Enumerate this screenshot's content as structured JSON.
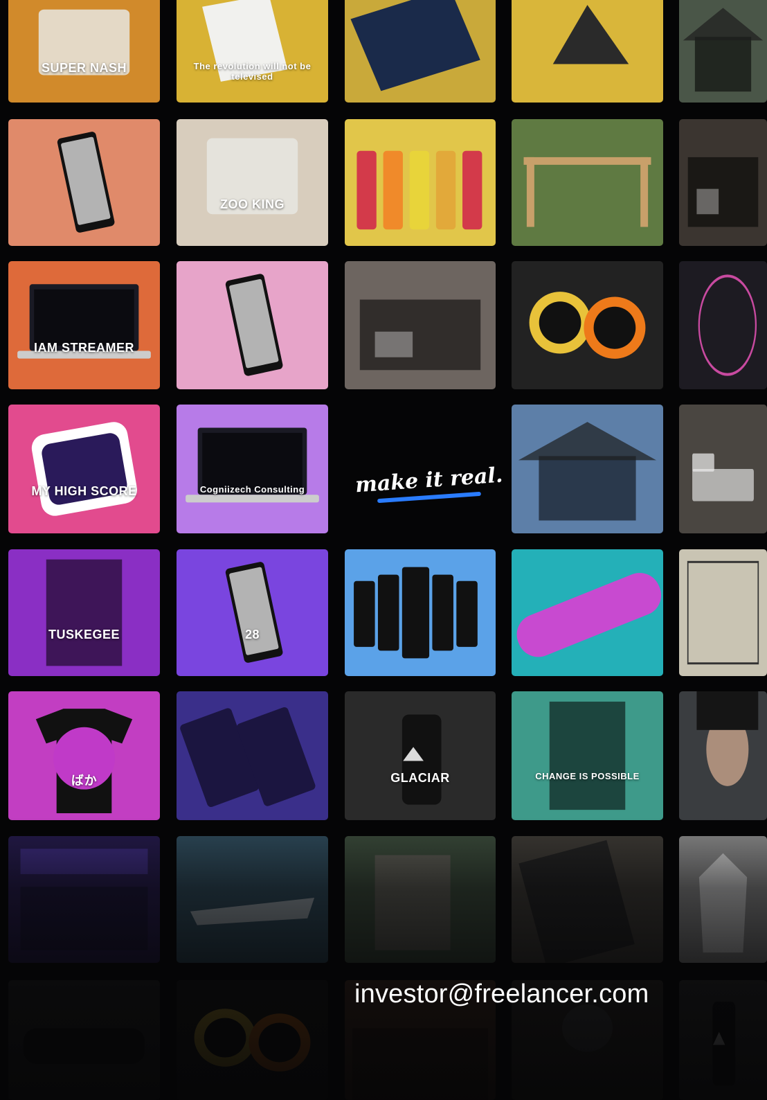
{
  "tagline": "make it real.",
  "contact": {
    "email": "investor@freelancer.com"
  },
  "tiles": [
    {
      "id": "r1c1",
      "color": "#d18a2b",
      "label": "SUPER NASH",
      "icon": "package-box-icon"
    },
    {
      "id": "r1c2",
      "color": "#d8b234",
      "label": "The revolution will not be televised",
      "icon": "newspaper-icon"
    },
    {
      "id": "r1c3",
      "color": "#c9a93a",
      "label": "",
      "icon": "book-icon"
    },
    {
      "id": "r1c4",
      "color": "#d9b63a",
      "label": "",
      "icon": "speaker-icon"
    },
    {
      "id": "r1c5",
      "color": "#4a5648",
      "label": "",
      "icon": "house-icon"
    },
    {
      "id": "r2c1",
      "color": "#e08a6a",
      "label": "",
      "icon": "phone-icon"
    },
    {
      "id": "r2c2",
      "color": "#d8cdbd",
      "label": "ZOO KING",
      "icon": "package-box-icon"
    },
    {
      "id": "r2c3",
      "color": "#e1c64a",
      "label": "",
      "icon": "bottles-icon"
    },
    {
      "id": "r2c4",
      "color": "#5f7a42",
      "label": "",
      "icon": "pergola-icon"
    },
    {
      "id": "r2c5",
      "color": "#3b3530",
      "label": "",
      "icon": "interior-icon"
    },
    {
      "id": "r3c1",
      "color": "#de6a3a",
      "label": "IAM STREAMER",
      "icon": "laptop-icon"
    },
    {
      "id": "r3c2",
      "color": "#e7a4c9",
      "label": "",
      "icon": "phone-icon"
    },
    {
      "id": "r3c3",
      "color": "#6d6560",
      "label": "",
      "icon": "interior-icon"
    },
    {
      "id": "r3c4",
      "color": "#222222",
      "label": "",
      "icon": "watch-icon"
    },
    {
      "id": "r3c5",
      "color": "#1d1b22",
      "label": "",
      "icon": "hud-icon"
    },
    {
      "id": "r4c1",
      "color": "#e24b8e",
      "label": "MY HIGH SCORE",
      "icon": "sticker-icon"
    },
    {
      "id": "r4c2",
      "color": "#b77be8",
      "label": "Cogniizech Consulting",
      "icon": "laptop-icon"
    },
    {
      "id": "r4c4",
      "color": "#5d7fa8",
      "label": "",
      "icon": "house-icon"
    },
    {
      "id": "r4c5",
      "color": "#4a4641",
      "label": "",
      "icon": "bed-icon"
    },
    {
      "id": "r5c1",
      "color": "#8a2fc4",
      "label": "TUSKEGEE",
      "icon": "poster-icon"
    },
    {
      "id": "r5c2",
      "color": "#7a45df",
      "label": "28",
      "icon": "phone-icon"
    },
    {
      "id": "r5c3",
      "color": "#5ba2e8",
      "label": "",
      "icon": "phones-icon"
    },
    {
      "id": "r5c4",
      "color": "#24b0b8",
      "label": "",
      "icon": "skateboard-icon"
    },
    {
      "id": "r5c5",
      "color": "#c9c4b3",
      "label": "",
      "icon": "comic-icon"
    },
    {
      "id": "r6c1",
      "color": "#c23ec2",
      "label": "ばか",
      "icon": "tshirt-icon"
    },
    {
      "id": "r6c2",
      "color": "#3a2f8a",
      "label": "",
      "icon": "tablet-icon"
    },
    {
      "id": "r6c3",
      "color": "#2a2a2a",
      "label": "GLACIAR",
      "icon": "bottle-icon"
    },
    {
      "id": "r6c4",
      "color": "#3e9a8a",
      "label": "CHANGE IS POSSIBLE",
      "icon": "poster-icon"
    },
    {
      "id": "r6c5",
      "color": "#3a3d40",
      "label": "",
      "icon": "portrait-icon"
    },
    {
      "id": "r7c1",
      "color": "#241a4a",
      "label": "",
      "icon": "dashboard-icon"
    },
    {
      "id": "r7c2",
      "color": "#2e4a5a",
      "label": "",
      "icon": "yacht-icon"
    },
    {
      "id": "r7c3",
      "color": "#3a4a3a",
      "label": "",
      "icon": "building-icon"
    },
    {
      "id": "r7c4",
      "color": "#3d3a35",
      "label": "",
      "icon": "magazine-icon"
    },
    {
      "id": "r7c5",
      "color": "#8a8a8a",
      "label": "",
      "icon": "hoodie-icon"
    },
    {
      "id": "r8c1",
      "color": "#2a2a2a",
      "label": "",
      "icon": "car-icon"
    },
    {
      "id": "r8c2",
      "color": "#1a1a1a",
      "label": "",
      "icon": "watch-icon"
    },
    {
      "id": "r8c3",
      "color": "#5a3a2a",
      "label": "",
      "icon": "temple-icon"
    },
    {
      "id": "r8c4",
      "color": "#3a3530",
      "label": "",
      "icon": "person-icon"
    },
    {
      "id": "r8c5",
      "color": "#3a3a3a",
      "label": "",
      "icon": "bottle-icon"
    }
  ]
}
